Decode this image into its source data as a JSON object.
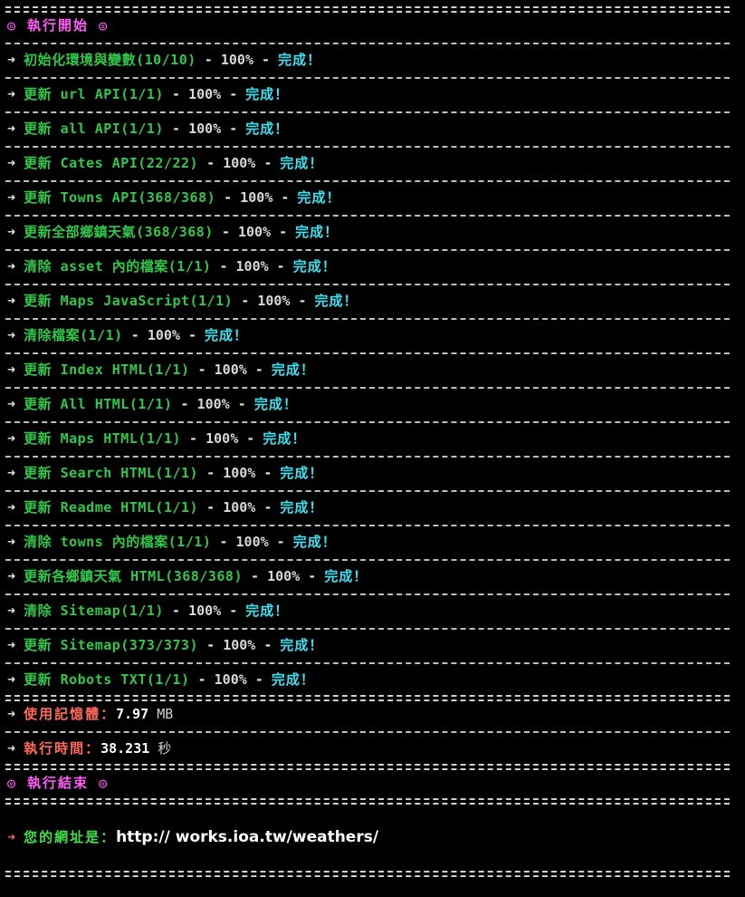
{
  "header": {
    "start_title": "◎ 執行開始 ◎",
    "end_title": "◎ 執行結束 ◎"
  },
  "arrow_glyph": "➜",
  "progress_label": "100%",
  "done_label": "完成！",
  "tasks": [
    {
      "label": "初始化環境與變數(10/10)",
      "progress": 100
    },
    {
      "label": "更新 url API(1/1)",
      "progress": 100
    },
    {
      "label": "更新 all API(1/1)",
      "progress": 100
    },
    {
      "label": "更新 Cates API(22/22)",
      "progress": 100
    },
    {
      "label": "更新 Towns API(368/368)",
      "progress": 100
    },
    {
      "label": "更新全部鄉鎮天氣(368/368)",
      "progress": 100
    },
    {
      "label": "清除 asset 內的檔案(1/1)",
      "progress": 100
    },
    {
      "label": "更新 Maps JavaScript(1/1)",
      "progress": 100
    },
    {
      "label": "清除檔案(1/1)",
      "progress": 100
    },
    {
      "label": "更新 Index HTML(1/1)",
      "progress": 100
    },
    {
      "label": "更新 All HTML(1/1)",
      "progress": 100
    },
    {
      "label": "更新 Maps HTML(1/1)",
      "progress": 100
    },
    {
      "label": "更新 Search HTML(1/1)",
      "progress": 100
    },
    {
      "label": "更新 Readme HTML(1/1)",
      "progress": 100
    },
    {
      "label": "清除 towns 內的檔案(1/1)",
      "progress": 100
    },
    {
      "label": "更新各鄉鎮天氣 HTML(368/368)",
      "progress": 100
    },
    {
      "label": "清除 Sitemap(1/1)",
      "progress": 100
    },
    {
      "label": "更新 Sitemap(373/373)",
      "progress": 100
    },
    {
      "label": "更新 Robots TXT(1/1)",
      "progress": 100
    }
  ],
  "stats": {
    "memory_label": "使用記憶體：",
    "memory_value": "7.97",
    "memory_unit": "MB",
    "time_label": "執行時間：",
    "time_value": "38.231",
    "time_unit": "秒"
  },
  "result": {
    "url_label": "您的網址是：",
    "url": "http:// works.ioa.tw/weathers/"
  },
  "colors": {
    "background": "#000000",
    "task_text": "#2fc84a",
    "done_text": "#3ee0ef",
    "title_text": "#ff5cf5",
    "stat_label": "#ff6a5c",
    "url_label": "#3ee04a"
  }
}
